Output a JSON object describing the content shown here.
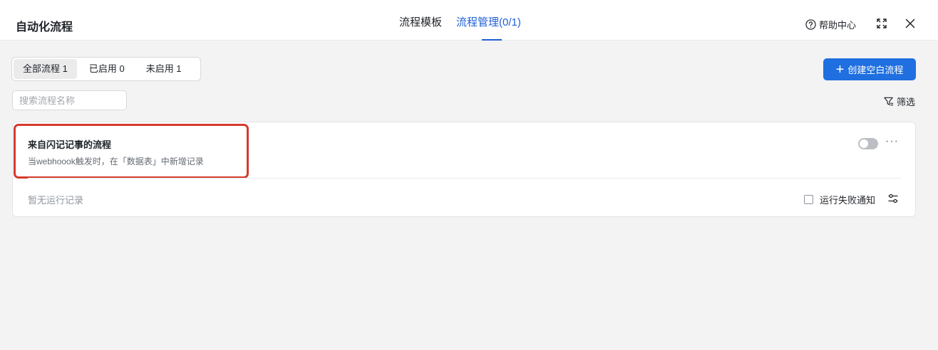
{
  "header": {
    "title": "自动化流程",
    "tabs": [
      {
        "label": "流程模板",
        "active": false
      },
      {
        "label": "流程管理(0/1)",
        "active": true
      }
    ],
    "help_label": "帮助中心"
  },
  "toolbar": {
    "segments": [
      {
        "label": "全部流程 1",
        "active": true
      },
      {
        "label": "已启用 0",
        "active": false
      },
      {
        "label": "未启用 1",
        "active": false
      }
    ],
    "create_label": "创建空白流程",
    "search_placeholder": "搜索流程名称",
    "filter_label": "筛选"
  },
  "flows": [
    {
      "name": "来自闪记记事的流程",
      "description": "当webhoook触发时，在「数据表」中新增记录",
      "enabled": false,
      "run_status": "暂无运行记录",
      "notify_label": "运行失败通知",
      "notify_checked": false
    }
  ],
  "colors": {
    "accent": "#1f6fe0",
    "highlight": "#d53a2c"
  }
}
